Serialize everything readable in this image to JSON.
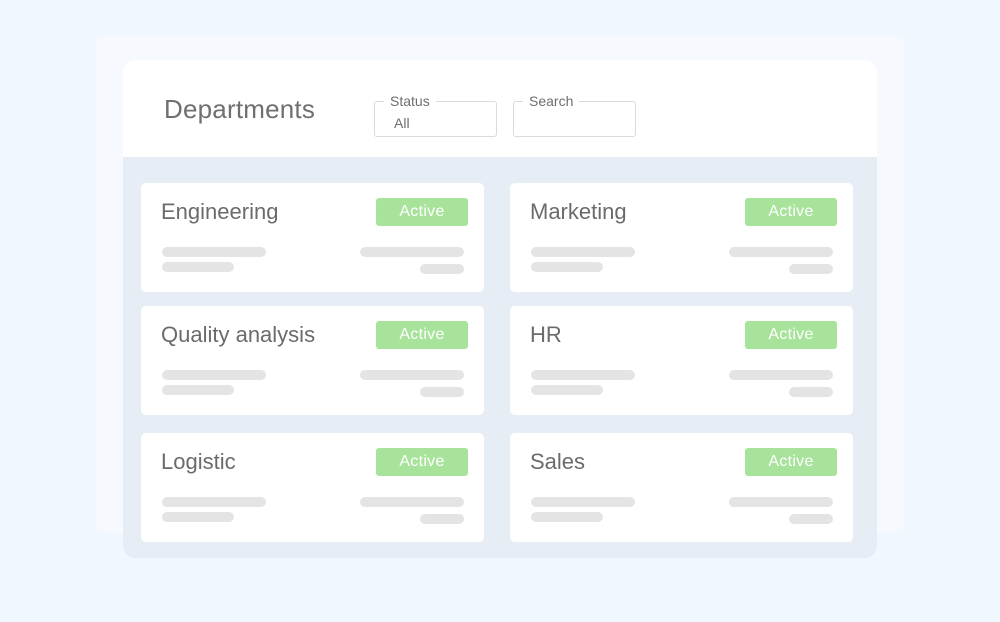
{
  "header": {
    "title": "Departments",
    "status_filter": {
      "label": "Status",
      "value": "All"
    },
    "search": {
      "label": "Search",
      "value": ""
    }
  },
  "departments": [
    {
      "name": "Engineering",
      "status": "Active"
    },
    {
      "name": "Marketing",
      "status": "Active"
    },
    {
      "name": "Quality analysis",
      "status": "Active"
    },
    {
      "name": "HR",
      "status": "Active"
    },
    {
      "name": "Logistic",
      "status": "Active"
    },
    {
      "name": "Sales",
      "status": "Active"
    }
  ],
  "colors": {
    "active_badge": "#a7e39a",
    "panel_background": "#e7edf4",
    "page_background": "#f1f7fe"
  }
}
